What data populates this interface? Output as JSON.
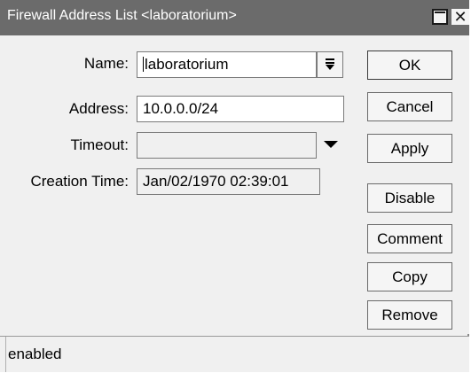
{
  "window": {
    "title": "Firewall Address List <laboratorium>",
    "maximize_icon": "maximize-icon",
    "close_icon": "close-icon"
  },
  "form": {
    "name_label": "Name:",
    "name_value": "laboratorium",
    "address_label": "Address:",
    "address_value": "10.0.0.0/24",
    "timeout_label": "Timeout:",
    "timeout_value": "",
    "creation_time_label": "Creation Time:",
    "creation_time_value": "Jan/02/1970 02:39:01"
  },
  "buttons": {
    "ok": "OK",
    "cancel": "Cancel",
    "apply": "Apply",
    "disable": "Disable",
    "comment": "Comment",
    "copy": "Copy",
    "remove": "Remove"
  },
  "status": {
    "text": "enabled"
  }
}
